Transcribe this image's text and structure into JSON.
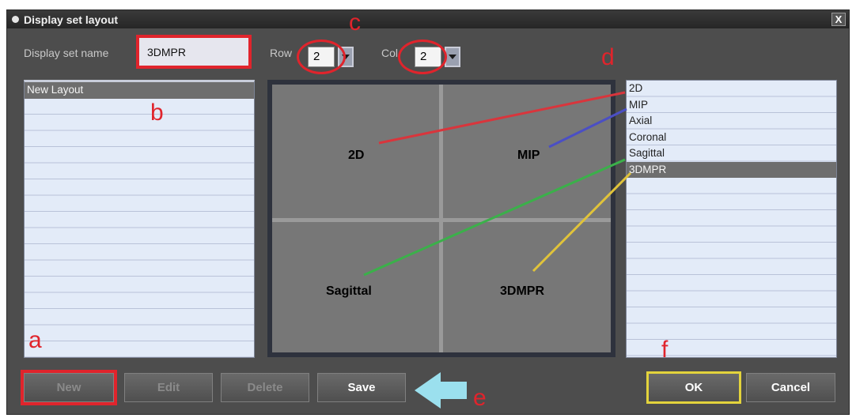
{
  "window": {
    "title": "Display set layout",
    "close_glyph": "X"
  },
  "form": {
    "name_label": "Display set name",
    "name_value": "3DMPR",
    "row_label": "Row",
    "row_value": "2",
    "col_label": "Col",
    "col_value": "2"
  },
  "layouts": {
    "items": [
      "New Layout"
    ]
  },
  "preview": {
    "cells": [
      "2D",
      "MIP",
      "Sagittal",
      "3DMPR"
    ]
  },
  "view_types": {
    "items": [
      "2D",
      "MIP",
      "Axial",
      "Coronal",
      "Sagittal",
      "3DMPR"
    ],
    "selected": "3DMPR"
  },
  "buttons": {
    "new": "New",
    "edit": "Edit",
    "delete": "Delete",
    "save": "Save",
    "ok": "OK",
    "cancel": "Cancel"
  },
  "annotations": {
    "a": "a",
    "b": "b",
    "c": "c",
    "d": "d",
    "e": "e",
    "f": "f"
  },
  "colors": {
    "annotation_red": "#e0242c",
    "annotation_yellow": "#e3d33c",
    "line_2d": "#d9353c",
    "line_mip": "#4b4fc4",
    "line_sagittal": "#3bb04a",
    "line_3dmpr": "#e0c33a",
    "arrow": "#9be0ee"
  },
  "icons": {
    "title": "bullet-icon",
    "combo": "dropdown-arrow-icon",
    "pointer": "left-arrow-icon"
  }
}
